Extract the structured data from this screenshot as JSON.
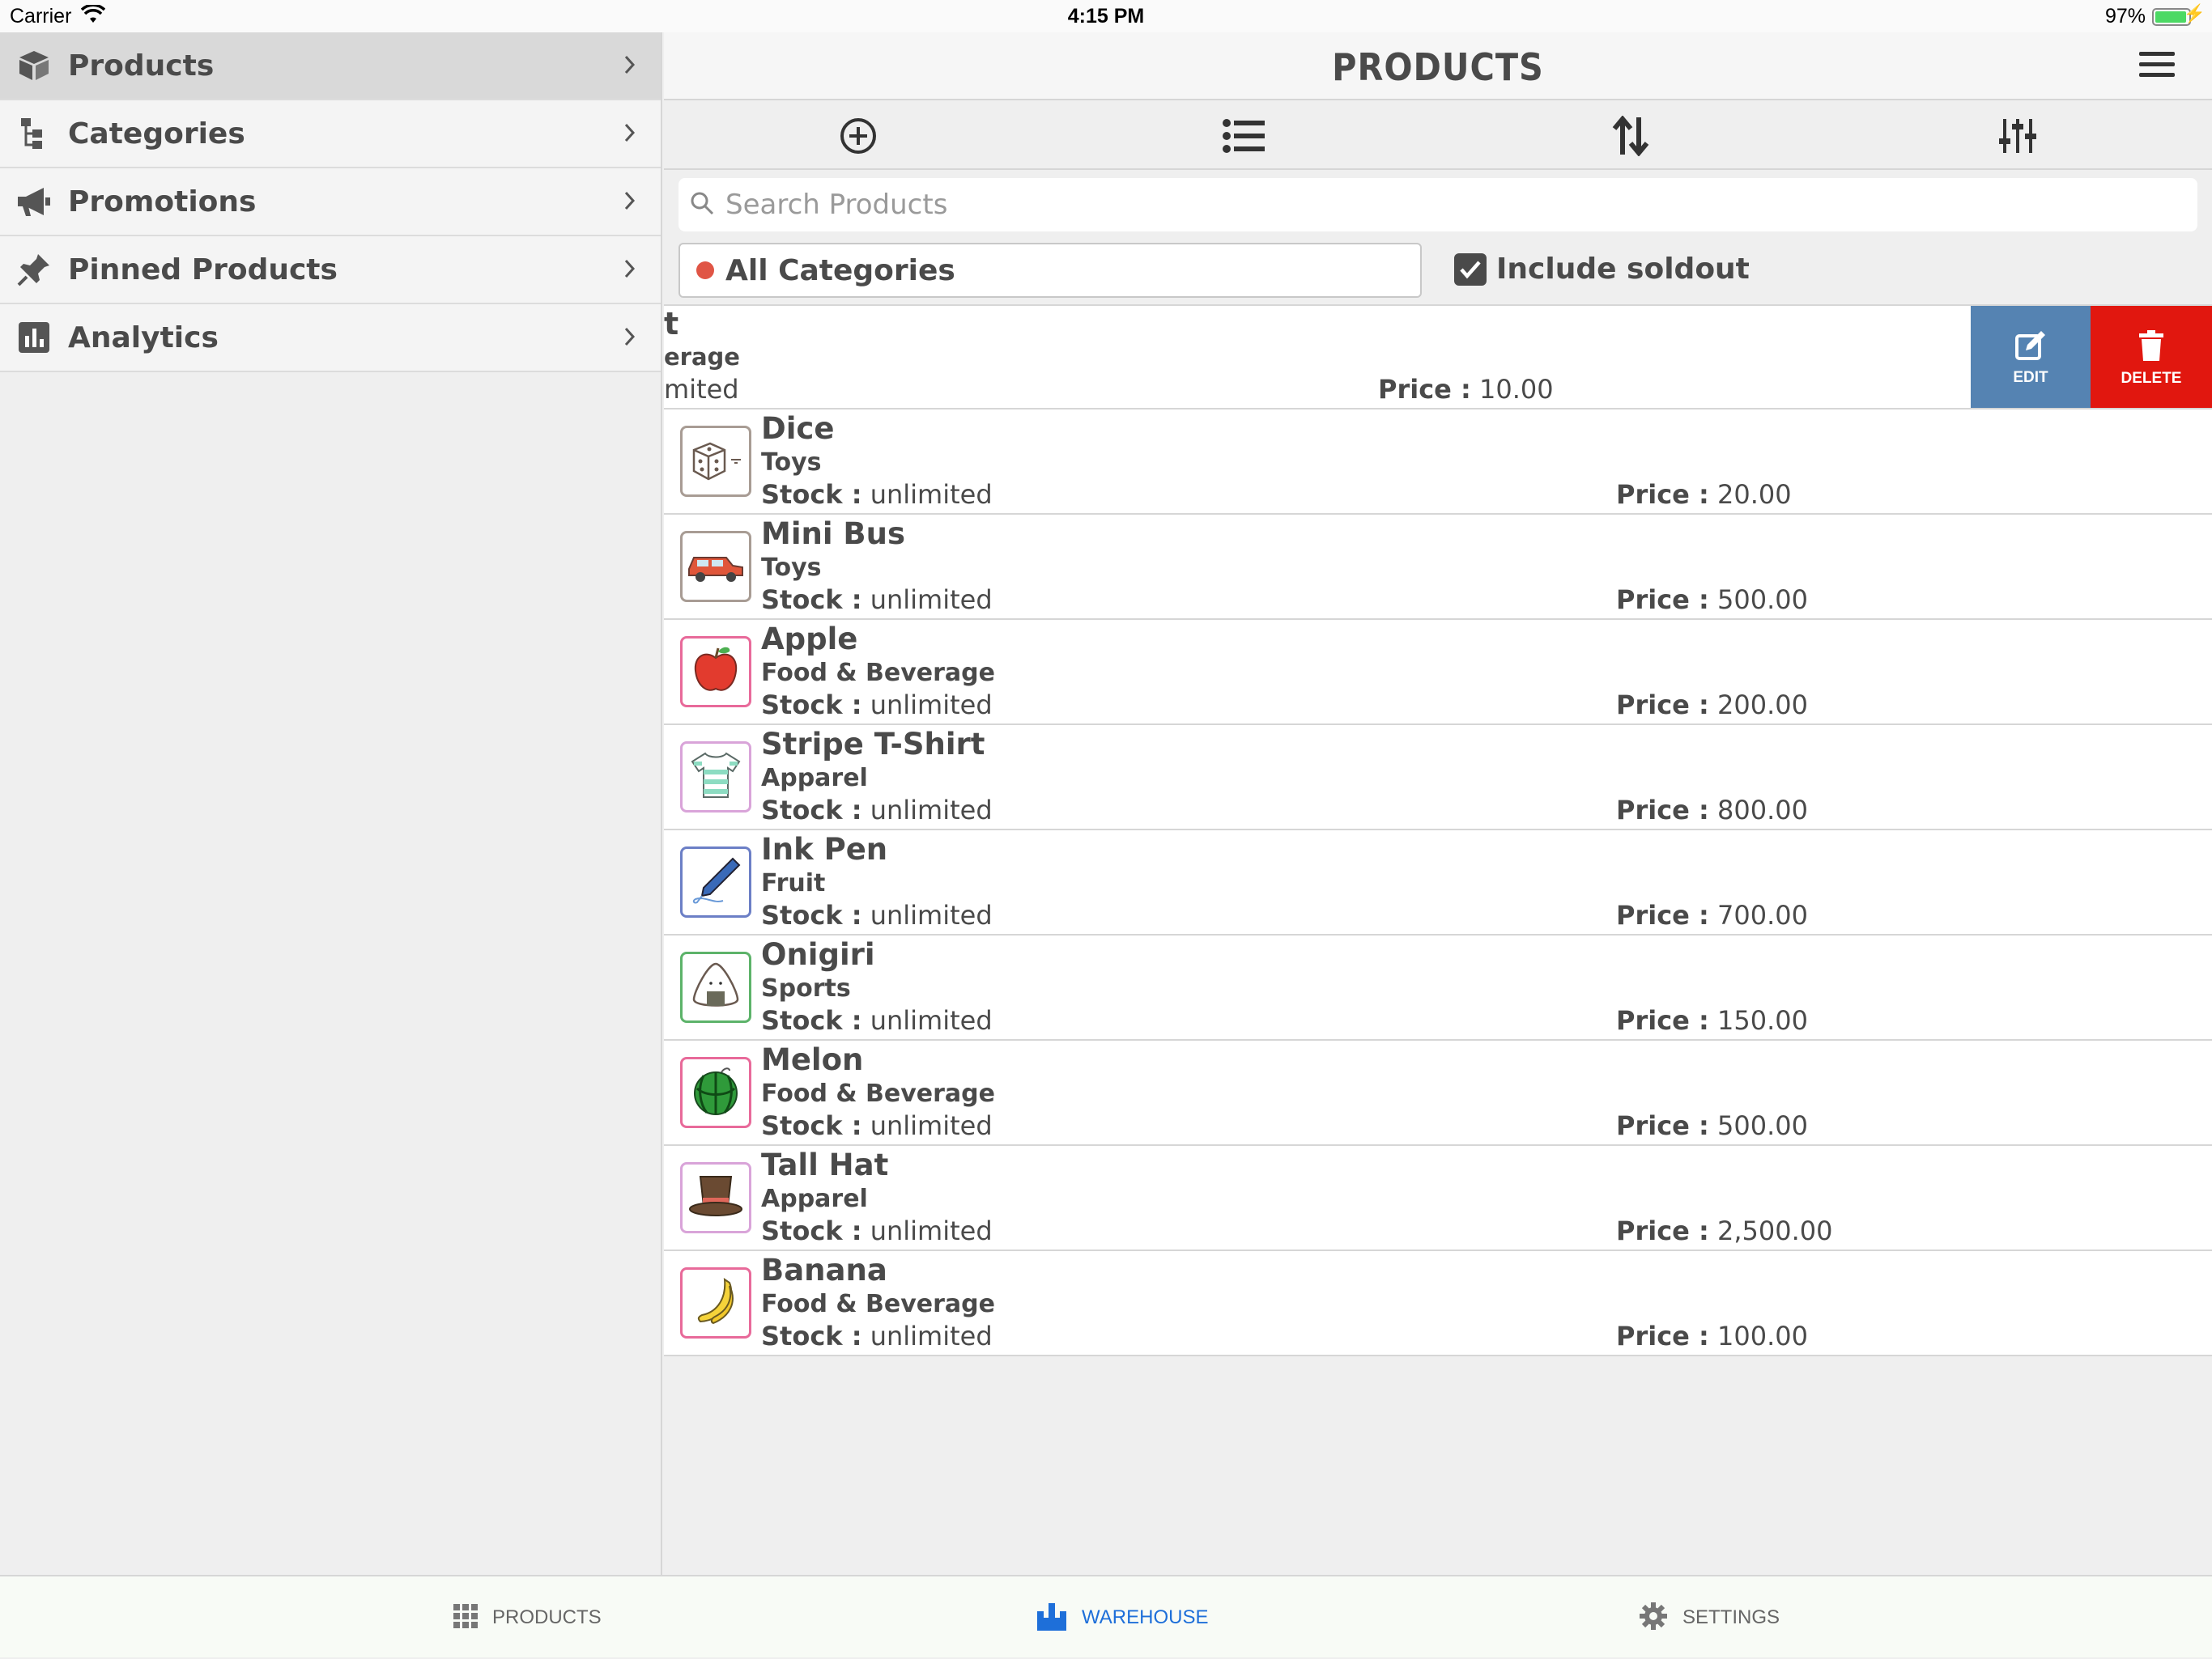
{
  "status_bar": {
    "carrier": "Carrier",
    "time": "4:15 PM",
    "battery": "97%"
  },
  "sidebar": {
    "items": [
      {
        "label": "Products",
        "icon": "box-icon",
        "active": true
      },
      {
        "label": "Categories",
        "icon": "hierarchy-icon",
        "active": false
      },
      {
        "label": "Promotions",
        "icon": "megaphone-icon",
        "active": false
      },
      {
        "label": "Pinned Products",
        "icon": "pin-icon",
        "active": false
      },
      {
        "label": "Analytics",
        "icon": "bar-chart-icon",
        "active": false
      }
    ]
  },
  "header": {
    "title": "PRODUCTS"
  },
  "search": {
    "placeholder": "Search Products",
    "value": ""
  },
  "filter": {
    "category": "All Categories",
    "include_soldout_label": "Include soldout",
    "include_soldout_checked": true
  },
  "swiped_row": {
    "name_fragment": "t",
    "category_fragment": "erage",
    "stock_fragment": "mited",
    "price_label": "Price :",
    "price": "10.00",
    "edit_label": "EDIT",
    "delete_label": "DELETE"
  },
  "labels": {
    "stock": "Stock :",
    "price": "Price :"
  },
  "products": [
    {
      "name": "Dice",
      "category": "Toys",
      "stock": "unlimited",
      "price": "20.00",
      "icon": "dice-icon",
      "border": "#a89c94"
    },
    {
      "name": "Mini Bus",
      "category": "Toys",
      "stock": "unlimited",
      "price": "500.00",
      "icon": "car-icon",
      "border": "#a89c94"
    },
    {
      "name": "Apple",
      "category": "Food & Beverage",
      "stock": "unlimited",
      "price": "200.00",
      "icon": "apple-icon",
      "border": "#e86a9a"
    },
    {
      "name": "Stripe T-Shirt",
      "category": "Apparel",
      "stock": "unlimited",
      "price": "800.00",
      "icon": "tshirt-icon",
      "border": "#d9a4d9"
    },
    {
      "name": "Ink Pen",
      "category": "Fruit",
      "stock": "unlimited",
      "price": "700.00",
      "icon": "pen-icon",
      "border": "#6c7fc6"
    },
    {
      "name": "Onigiri",
      "category": "Sports",
      "stock": "unlimited",
      "price": "150.00",
      "icon": "onigiri-icon",
      "border": "#5db36a"
    },
    {
      "name": "Melon",
      "category": "Food & Beverage",
      "stock": "unlimited",
      "price": "500.00",
      "icon": "watermelon-icon",
      "border": "#e86a9a"
    },
    {
      "name": "Tall Hat",
      "category": "Apparel",
      "stock": "unlimited",
      "price": "2,500.00",
      "icon": "hat-icon",
      "border": "#d9a4d9"
    },
    {
      "name": "Banana",
      "category": "Food & Beverage",
      "stock": "unlimited",
      "price": "100.00",
      "icon": "banana-icon",
      "border": "#e86a9a"
    }
  ],
  "tab_bar": {
    "tabs": [
      {
        "label": "PRODUCTS",
        "icon": "grid-icon",
        "active": false
      },
      {
        "label": "WAREHOUSE",
        "icon": "warehouse-icon",
        "active": true
      },
      {
        "label": "SETTINGS",
        "icon": "gear-icon",
        "active": false
      }
    ]
  },
  "colors": {
    "accent": "#1e6fd9",
    "edit": "#5583b2",
    "delete": "#e1170f",
    "category_dot": "#e05545"
  }
}
